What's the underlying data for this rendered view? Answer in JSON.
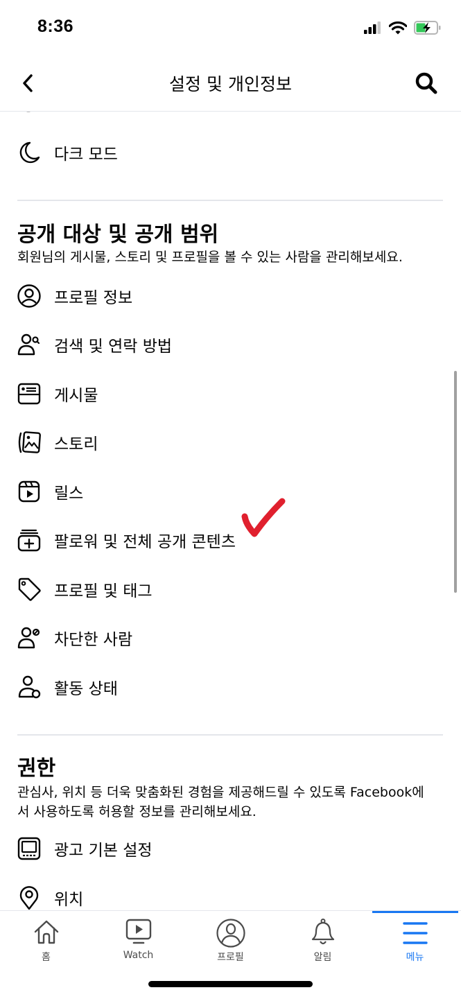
{
  "status_bar": {
    "time": "8:36",
    "battery_state": "charging",
    "battery_color": "#34c759"
  },
  "header": {
    "title": "설정 및 개인정보",
    "back_icon": "chevron-left-icon",
    "search_icon": "search-icon"
  },
  "top_items": [
    {
      "label": "다크 모드",
      "icon": "moon-icon"
    }
  ],
  "sections": [
    {
      "title": "공개 대상 및 공개 범위",
      "description": "회원님의 게시물, 스토리 및 프로필을 볼 수 있는 사람을 관리해보세요.",
      "items": [
        {
          "label": "프로필 정보",
          "icon": "profile-circle-icon"
        },
        {
          "label": "검색 및 연락 방법",
          "icon": "person-search-icon"
        },
        {
          "label": "게시물",
          "icon": "post-icon"
        },
        {
          "label": "스토리",
          "icon": "story-icon"
        },
        {
          "label": "릴스",
          "icon": "reels-icon"
        },
        {
          "label": "팔로워 및 전체 공개 콘텐츠",
          "icon": "followers-add-icon"
        },
        {
          "label": "프로필 및 태그",
          "icon": "tag-icon"
        },
        {
          "label": "차단한 사람",
          "icon": "person-blocked-icon"
        },
        {
          "label": "활동 상태",
          "icon": "activity-status-icon"
        }
      ]
    },
    {
      "title": "권한",
      "description": "관심사, 위치 등 더욱 맞춤화된 경험을 제공해드릴 수 있도록 Facebook에서 사용하도록 허용할 정보를 관리해보세요.",
      "items": [
        {
          "label": "광고 기본 설정",
          "icon": "ad-preferences-icon"
        },
        {
          "label": "위치",
          "icon": "location-pin-icon"
        }
      ]
    }
  ],
  "annotation": {
    "type": "hand-drawn-checkmark",
    "color": "#e0202e",
    "target": "팔로워 및 전체 공개 콘텐츠"
  },
  "tab_bar": {
    "accent": "#1877f2",
    "active": "메뉴",
    "tabs": [
      {
        "label": "홈",
        "icon": "home-icon"
      },
      {
        "label": "Watch",
        "icon": "watch-icon"
      },
      {
        "label": "프로필",
        "icon": "profile-icon"
      },
      {
        "label": "알림",
        "icon": "bell-icon"
      },
      {
        "label": "메뉴",
        "icon": "menu-icon"
      }
    ]
  }
}
